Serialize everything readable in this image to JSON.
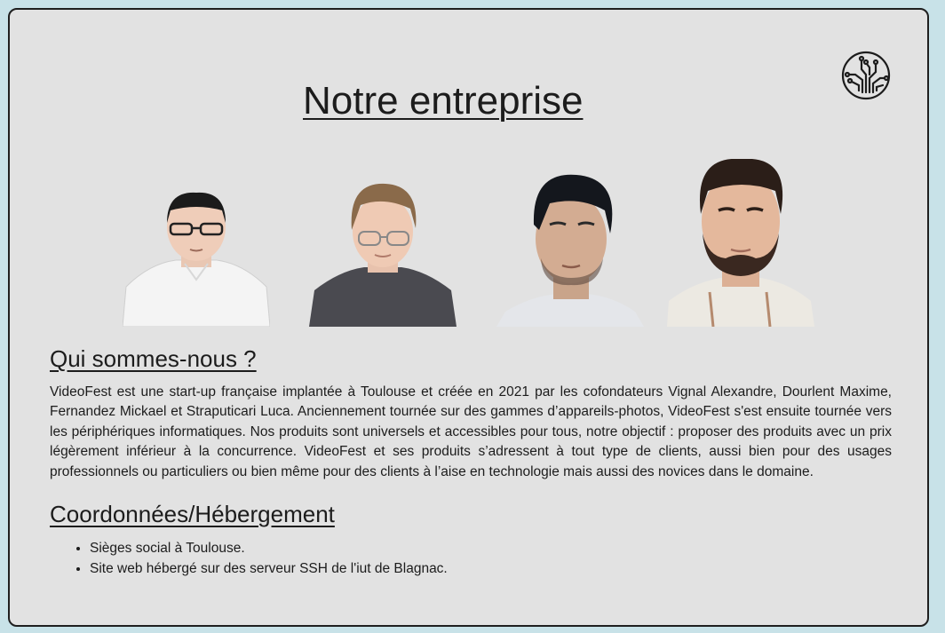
{
  "page": {
    "title": "Notre entreprise",
    "logo_icon": "circuit-globe-icon"
  },
  "team_photos": [
    {
      "name": "team-photo-1",
      "shirt_color": "#f4f4f4"
    },
    {
      "name": "team-photo-2",
      "shirt_color": "#4a4a50"
    },
    {
      "name": "team-photo-3",
      "shirt_color": "#e4e6ea"
    },
    {
      "name": "team-photo-4",
      "shirt_color": "#ece9e2"
    }
  ],
  "about": {
    "heading": "Qui sommes-nous ?",
    "text": "VideoFest est une start-up française implantée à Toulouse et créée en 2021 par les cofondateurs Vignal Alexandre, Dourlent Maxime, Fernandez Mickael et Straputicari Luca. Anciennement tournée sur des gammes d’appareils-photos, VideoFest s'est ensuite tournée vers les périphériques informatiques. Nos produits sont universels et accessibles pour tous, notre objectif : proposer des produits avec un prix légèrement inférieur à la concurrence. VideoFest et ses produits s’adressent à tout type de clients, aussi bien pour des usages professionnels ou particuliers ou bien même pour des clients à l’aise en technologie mais aussi des novices dans le domaine."
  },
  "contact": {
    "heading": "Coordonnées/Hébergement",
    "items": [
      "Sièges social à Toulouse.",
      "Site web hébergé sur des serveur SSH de l'iut de Blagnac."
    ]
  },
  "colors": {
    "background": "#c8e2e8",
    "card": "#e2e2e2",
    "text": "#1c1c1c"
  }
}
